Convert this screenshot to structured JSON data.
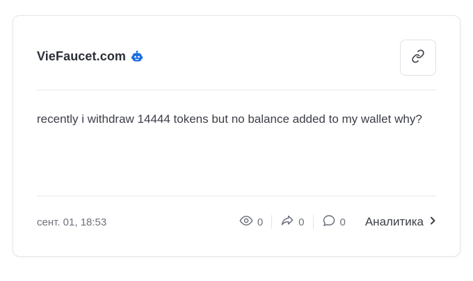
{
  "post": {
    "channel_name": "VieFaucet.com",
    "message": "recently i withdraw 14444 tokens but no balance added to my wallet why?",
    "date": "сент. 01, 18:53",
    "views": "0",
    "shares": "0",
    "comments": "0",
    "analytics_label": "Аналитика"
  },
  "icons": {
    "bot": "bot-icon",
    "link": "link-icon",
    "views": "eye-icon",
    "shares": "share-icon",
    "comments": "comment-icon",
    "analytics": "chevron-right-icon"
  },
  "colors": {
    "bot_icon": "#1a6fe0",
    "text_primary": "#2b2f36",
    "text_secondary": "#6b7079"
  }
}
